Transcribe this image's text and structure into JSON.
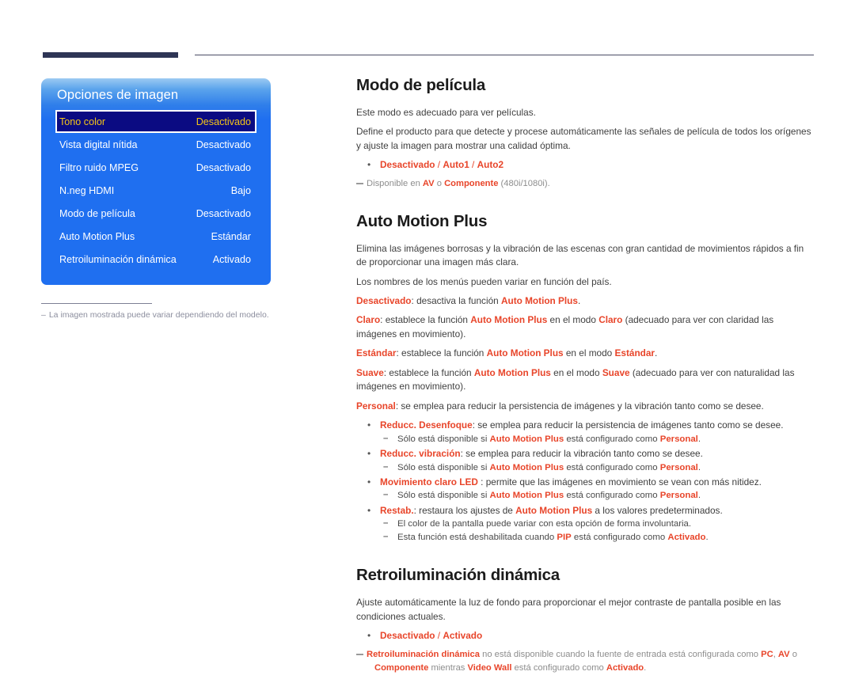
{
  "page": {
    "rules": {
      "thick_color": "#2e3555",
      "thin_color": "#4a4c66"
    }
  },
  "osd": {
    "title": "Opciones de imagen",
    "accent_bg": "#1f6ff0",
    "selected_bg": "#0b0b82",
    "selected_text": "#f5c518",
    "rows": [
      {
        "label": "Tono color",
        "value": "Desactivado",
        "selected": true
      },
      {
        "label": "Vista digital nítida",
        "value": "Desactivado",
        "selected": false
      },
      {
        "label": "Filtro ruido MPEG",
        "value": "Desactivado",
        "selected": false
      },
      {
        "label": "N.neg HDMI",
        "value": "Bajo",
        "selected": false
      },
      {
        "label": "Modo de película",
        "value": "Desactivado",
        "selected": false
      },
      {
        "label": "Auto Motion Plus",
        "value": "Estándar",
        "selected": false
      },
      {
        "label": "Retroiluminación dinámica",
        "value": "Activado",
        "selected": false
      }
    ],
    "caption_dash": "–",
    "caption": "La imagen mostrada puede variar dependiendo del modelo."
  },
  "sections": {
    "movie_mode": {
      "heading": "Modo de película",
      "p1": "Este modo es adecuado para ver películas.",
      "p2": "Define el producto para que detecte y procese automáticamente las señales de película de todos los orígenes y ajuste la imagen para mostrar una calidad óptima.",
      "option_off": "Desactivado",
      "sep1": " / ",
      "option_auto1": "Auto1",
      "sep2": " / ",
      "option_auto2": "Auto2",
      "note_pre": "Disponible en ",
      "note_av": "AV",
      "note_mid": " o ",
      "note_comp": "Componente",
      "note_post": " (480i/1080i)."
    },
    "auto_motion_plus": {
      "heading": "Auto Motion Plus",
      "p1": "Elimina las imágenes borrosas y la vibración de las escenas con gran cantidad de movimientos rápidos a fin de proporcionar una imagen más clara.",
      "p2": "Los nombres de los menús pueden variar en función del país.",
      "off_term": "Desactivado",
      "off_mid": ": desactiva la función ",
      "off_amp": "Auto Motion Plus",
      "off_end": ".",
      "claro_term": "Claro",
      "claro_mid": ": establece la función ",
      "claro_amp": "Auto Motion Plus",
      "claro_mid2": " en el modo ",
      "claro_mode": "Claro",
      "claro_end": " (adecuado para ver con claridad las imágenes en movimiento).",
      "std_term": "Estándar",
      "std_mid": ": establece la función ",
      "std_amp": "Auto Motion Plus",
      "std_mid2": " en el modo ",
      "std_mode": "Estándar",
      "std_end": ".",
      "suave_term": "Suave",
      "suave_mid": ": establece la función ",
      "suave_amp": "Auto Motion Plus",
      "suave_mid2": " en el modo ",
      "suave_mode": "Suave",
      "suave_end": " (adecuado para ver con naturalidad las imágenes en movimiento).",
      "personal_term": "Personal",
      "personal_end": ": se emplea para reducir la persistencia de imágenes y la vibración tanto como se desee.",
      "b1_term": "Reducc. Desenfoque",
      "b1_end": ": se emplea para reducir la persistencia de imágenes tanto como se desee.",
      "b1_sub_pre": "Sólo está disponible si ",
      "b1_sub_amp": "Auto Motion Plus",
      "b1_sub_mid": " está configurado como ",
      "b1_sub_val": "Personal",
      "b1_sub_end": ".",
      "b2_term": "Reducc. vibración",
      "b2_end": ": se emplea para reducir la vibración tanto como se desee.",
      "b2_sub_pre": "Sólo está disponible si ",
      "b2_sub_amp": "Auto Motion Plus",
      "b2_sub_mid": " está configurado como ",
      "b2_sub_val": "Personal",
      "b2_sub_end": ".",
      "b3_term": "Movimiento claro LED",
      "b3_end": " : permite que las imágenes en movimiento se vean con más nitidez.",
      "b3_sub_pre": "Sólo está disponible si ",
      "b3_sub_amp": "Auto Motion Plus",
      "b3_sub_mid": " está configurado como ",
      "b3_sub_val": "Personal",
      "b3_sub_end": ".",
      "b4_term": "Restab.",
      "b4_mid": ": restaura los ajustes de ",
      "b4_amp": "Auto Motion Plus",
      "b4_end": " a los valores predeterminados.",
      "b4_sub1": "El color de la pantalla puede variar con esta opción de forma involuntaria.",
      "b4_sub2_pre": "Esta función está deshabilitada cuando ",
      "b4_sub2_pip": "PIP",
      "b4_sub2_mid": " está configurado como ",
      "b4_sub2_val": "Activado",
      "b4_sub2_end": "."
    },
    "dynamic_backlight": {
      "heading": "Retroiluminación dinámica",
      "p1": "Ajuste automáticamente la luz de fondo para proporcionar el mejor contraste de pantalla posible en las condiciones actuales.",
      "option_off": "Desactivado",
      "sep": " / ",
      "option_on": "Activado",
      "note_term": "Retroiluminación dinámica",
      "note_mid": " no está disponible cuando la fuente de entrada está configurada como ",
      "note_pc": "PC",
      "note_c1": ", ",
      "note_av": "AV",
      "note_c2": " o",
      "note_comp": "Componente",
      "note_mid2": " mientras ",
      "note_vw": "Video Wall",
      "note_mid3": " está configurado como ",
      "note_act": "Activado",
      "note_end": "."
    }
  }
}
